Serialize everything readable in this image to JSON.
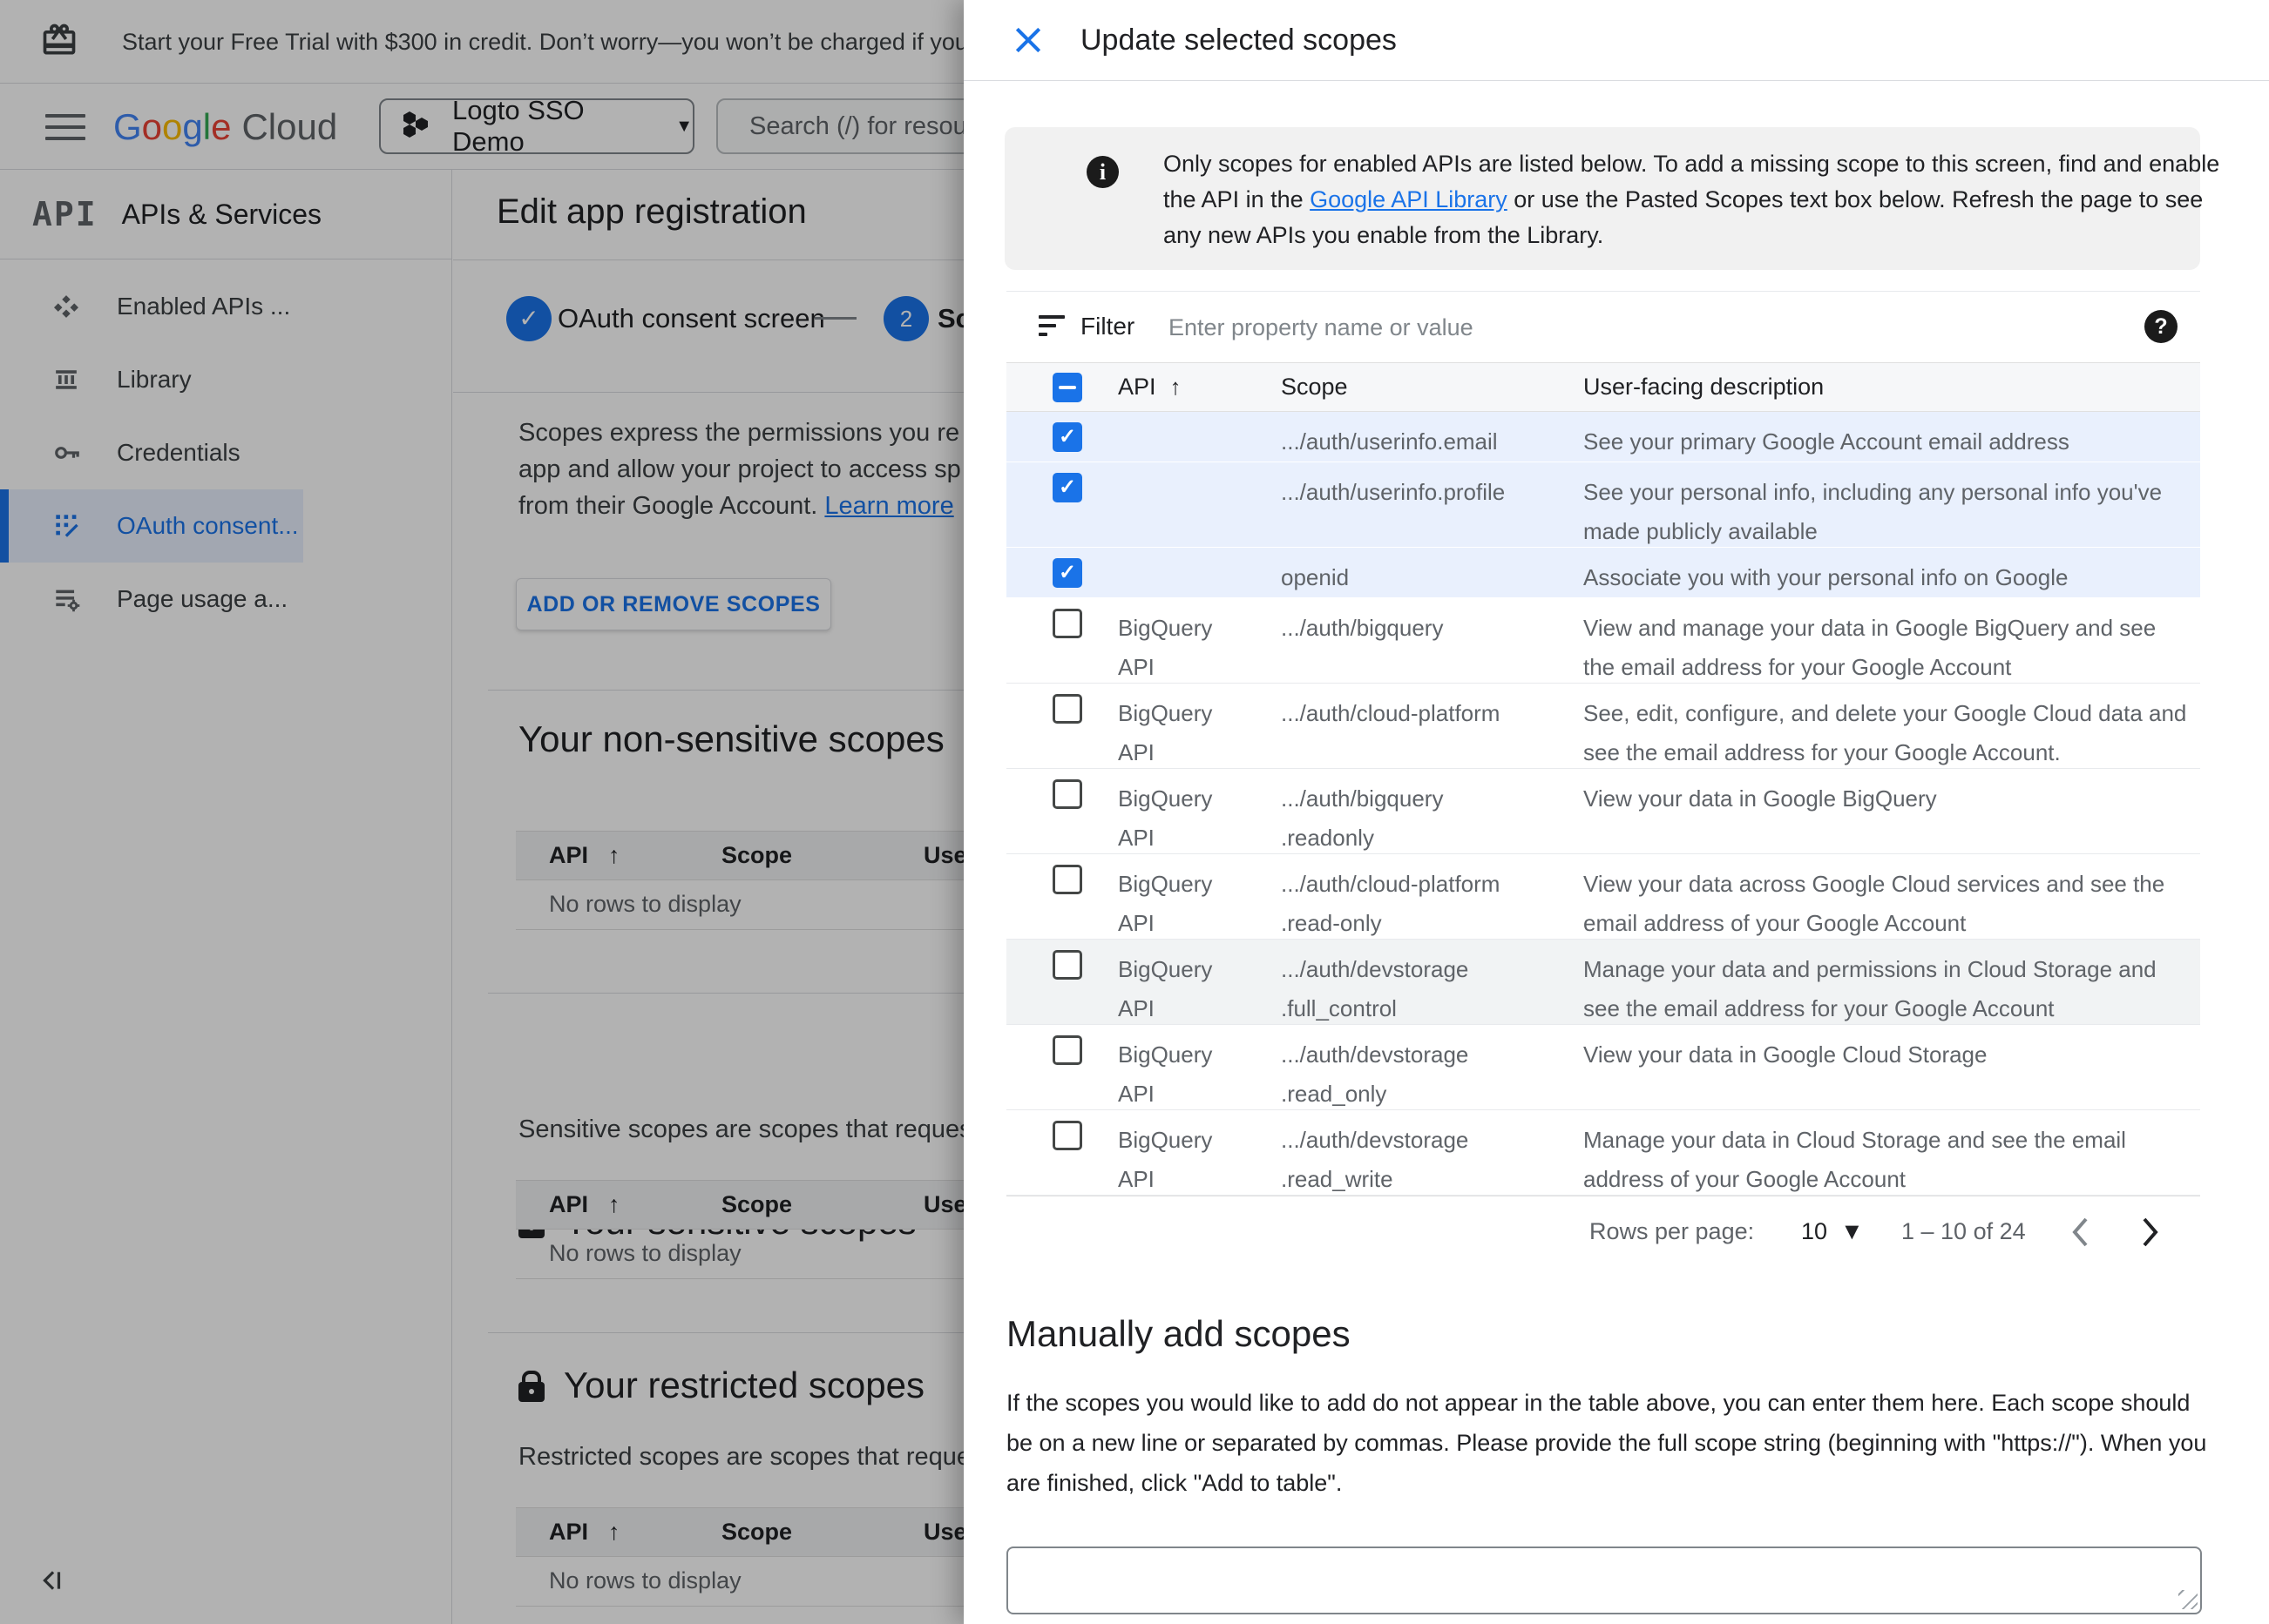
{
  "banner": {
    "text": "Start your Free Trial with $300 in credit. Don’t worry—you won’t be charged if you run out of c"
  },
  "header": {
    "logo_letters": [
      "G",
      "o",
      "o",
      "g",
      "l",
      "e"
    ],
    "logo_cloud": "Cloud",
    "project": "Logto SSO Demo",
    "search_placeholder": "Search (/) for resou"
  },
  "sidebar": {
    "logo": "API",
    "title": "APIs & Services",
    "items": [
      {
        "label": "Enabled APIs ...",
        "icon": "enabled-apis-icon",
        "selected": false
      },
      {
        "label": "Library",
        "icon": "library-icon",
        "selected": false
      },
      {
        "label": "Credentials",
        "icon": "credentials-icon",
        "selected": false
      },
      {
        "label": "OAuth consent...",
        "icon": "oauth-consent-icon",
        "selected": true
      },
      {
        "label": "Page usage a...",
        "icon": "page-usage-icon",
        "selected": false
      }
    ]
  },
  "main": {
    "title": "Edit app registration",
    "stepper": {
      "step1_label": "OAuth consent screen",
      "step2_number": "2",
      "step2_label": "Sco"
    },
    "intro_lines": [
      "Scopes express the permissions you re",
      "app and allow your project to access sp",
      "from their Google Account."
    ],
    "learn_more_label": "Learn more",
    "add_scopes_button": "ADD OR REMOVE SCOPES",
    "table_headers": {
      "api": "API",
      "sort": "↑",
      "scope": "Scope",
      "user": "User-"
    },
    "no_rows_text": "No rows to display",
    "sections": [
      {
        "title": "Your non-sensitive scopes",
        "desc": ""
      },
      {
        "title": "Your sensitive scopes",
        "desc": "Sensitive scopes are scopes that request acc"
      },
      {
        "title": "Your restricted scopes",
        "desc": "Restricted scopes are scopes that request ac"
      }
    ]
  },
  "panel": {
    "title": "Update selected scopes",
    "info": {
      "before": "Only scopes for enabled APIs are listed below. To add a missing scope to this screen, find and enable the API in the ",
      "link": "Google API Library",
      "after": " or use the Pasted Scopes text box below. Refresh the page to see any new APIs you enable from the Library."
    },
    "filter": {
      "label": "Filter",
      "placeholder": "Enter property name or value",
      "help_icon": "?"
    },
    "table": {
      "headers": {
        "api": "API",
        "sort": "↑",
        "scope": "Scope",
        "desc": "User-facing description"
      },
      "rows": [
        {
          "checked": true,
          "selected": true,
          "api": "",
          "scope_lines": [
            ".../auth/userinfo.email"
          ],
          "desc": "See your primary Google Account email address"
        },
        {
          "checked": true,
          "selected": true,
          "api": "",
          "scope_lines": [
            ".../auth/userinfo.profile"
          ],
          "desc": "See your personal info, including any personal info you've made publicly available"
        },
        {
          "checked": true,
          "selected": true,
          "api": "",
          "scope_lines": [
            "openid"
          ],
          "desc": "Associate you with your personal info on Google"
        },
        {
          "checked": false,
          "api": "BigQuery API",
          "scope_lines": [
            ".../auth/bigquery"
          ],
          "desc": "View and manage your data in Google BigQuery and see the email address for your Google Account"
        },
        {
          "checked": false,
          "api": "BigQuery API",
          "scope_lines": [
            ".../auth/cloud-platform"
          ],
          "desc": "See, edit, configure, and delete your Google Cloud data and see the email address for your Google Account."
        },
        {
          "checked": false,
          "api": "BigQuery API",
          "scope_lines": [
            ".../auth/bigquery",
            ".readonly"
          ],
          "desc": "View your data in Google BigQuery"
        },
        {
          "checked": false,
          "api": "BigQuery API",
          "scope_lines": [
            ".../auth/cloud-platform",
            ".read-only"
          ],
          "desc": "View your data across Google Cloud services and see the email address of your Google Account"
        },
        {
          "checked": false,
          "hover": true,
          "api": "BigQuery API",
          "scope_lines": [
            ".../auth/devstorage",
            ".full_control"
          ],
          "desc": "Manage your data and permissions in Cloud Storage and see the email address for your Google Account"
        },
        {
          "checked": false,
          "api": "BigQuery API",
          "scope_lines": [
            ".../auth/devstorage",
            ".read_only"
          ],
          "desc": "View your data in Google Cloud Storage"
        },
        {
          "checked": false,
          "api": "BigQuery API",
          "scope_lines": [
            ".../auth/devstorage",
            ".read_write"
          ],
          "desc": "Manage your data in Cloud Storage and see the email address of your Google Account"
        }
      ]
    },
    "pagination": {
      "label": "Rows per page:",
      "value": "10",
      "caret": "▼",
      "range": "1 – 10 of 24"
    },
    "manual": {
      "title": "Manually add scopes",
      "body": "If the scopes you would like to add do not appear in the table above, you can enter them here. Each scope should be on a new line or separated by commas. Please provide the full scope string (beginning with \"https://\"). When you are finished, click \"Add to table\".",
      "textarea_value": ""
    }
  },
  "icons": {
    "gift-icon": "gift",
    "menu-icon": "hamburger",
    "project-picker-icon": "hexagons",
    "dropdown-caret-icon": "▼",
    "close-icon": "✕",
    "info-icon": "i",
    "help-icon": "?",
    "filter-icon": "filter-list",
    "sort-ascending-icon": "↑",
    "check-icon": "✓",
    "lock-icon": "lock",
    "prev-page-icon": "‹",
    "next-page-icon": "›",
    "collapse-panel-icon": "‹|"
  },
  "colors": {
    "accent": "#1a73e8",
    "selected_row": "#e9f0fd",
    "link": "#1a73e8",
    "scrim": "rgba(0,0,0,0.30)"
  }
}
